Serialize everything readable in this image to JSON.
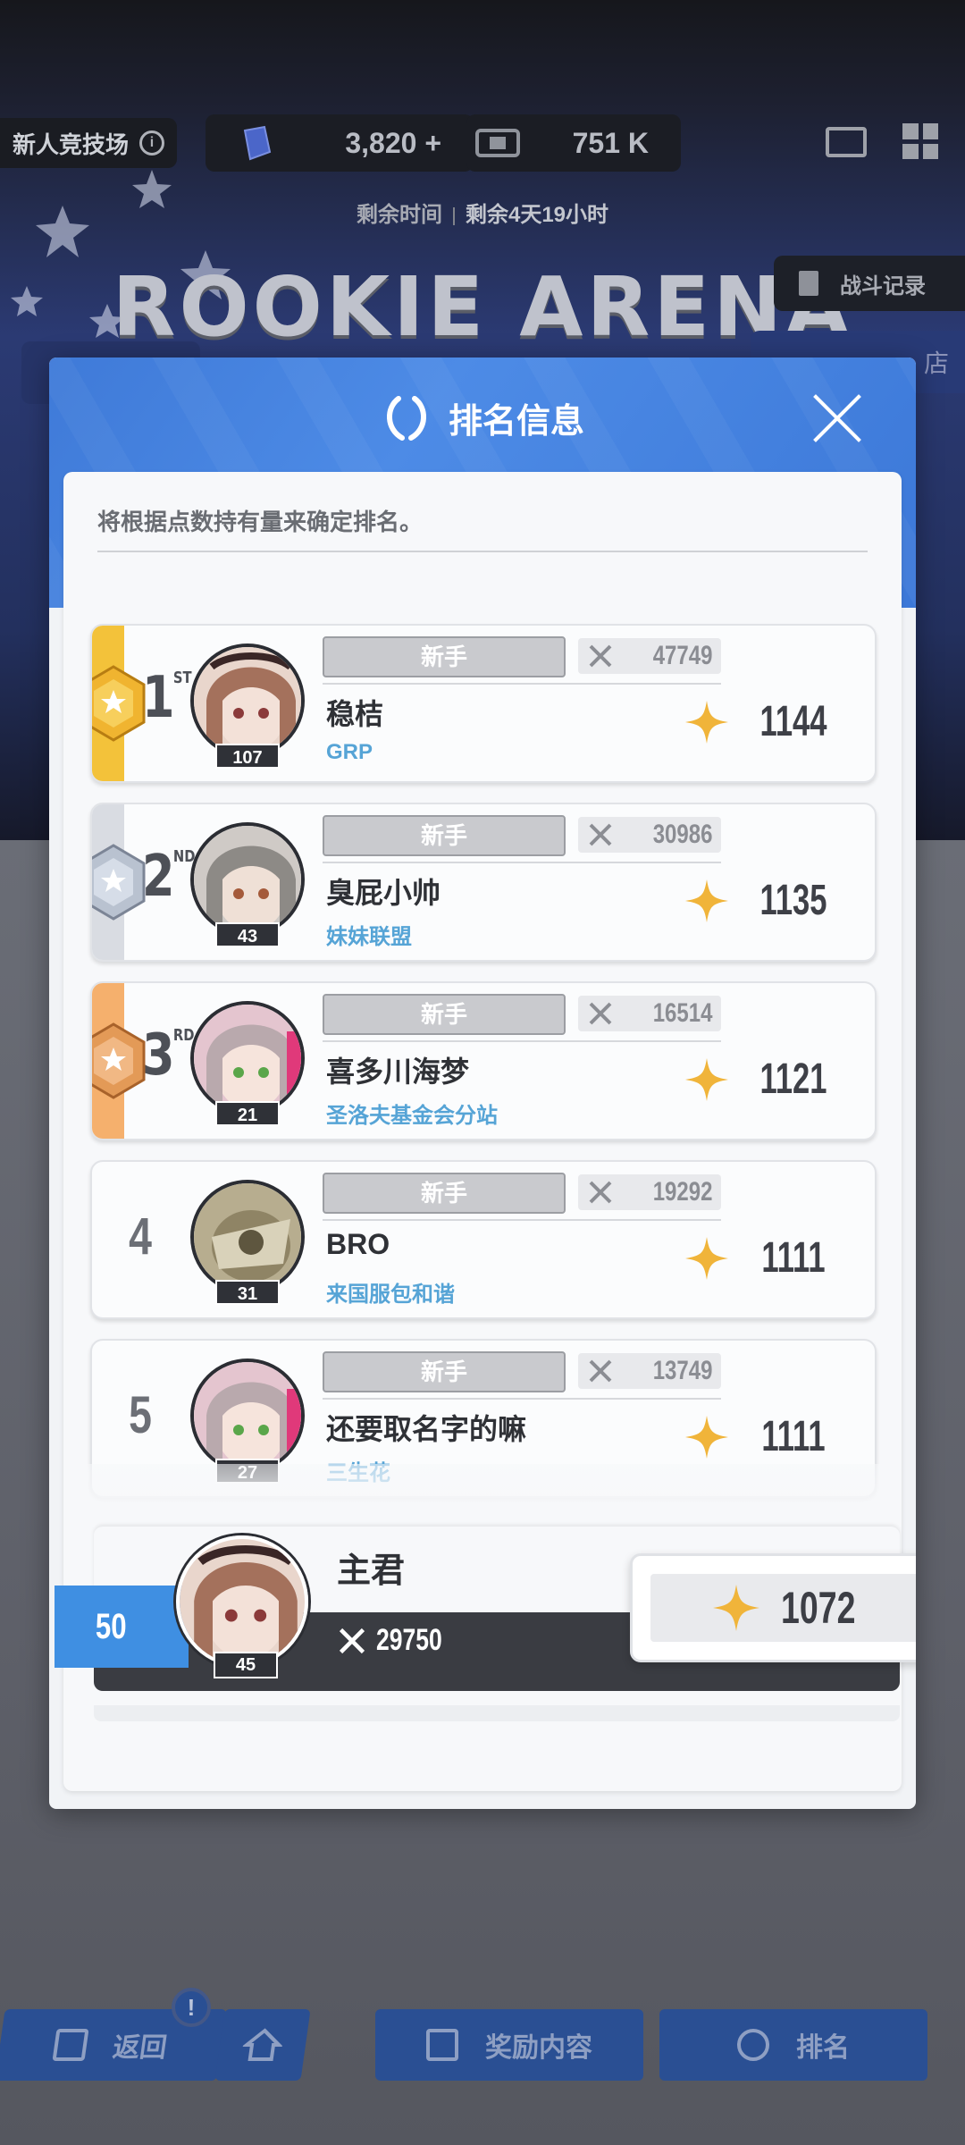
{
  "topbar": {
    "arena_tag": "新人竞技场",
    "info_icon": "i",
    "currency1_value": "3,820",
    "currency1_add": "+",
    "currency2_value": "751 K",
    "remaining_label": "剩余时间",
    "remaining_value": "剩余4天19小时",
    "arena_title": "ROOKIE ARENA",
    "battle_record": "战斗记录",
    "shop": "店"
  },
  "modal": {
    "title": "排名信息",
    "description": "将根据点数持有量来确定排名。"
  },
  "ranking": [
    {
      "rank": "1",
      "suffix": "ST",
      "level": "107",
      "tier": "新手",
      "power": "47749",
      "name": "稳桔",
      "guild": "GRP",
      "points": "1144",
      "medal": "gold"
    },
    {
      "rank": "2",
      "suffix": "ND",
      "level": "43",
      "tier": "新手",
      "power": "30986",
      "name": "臭屁小帅",
      "guild": "妹妹联盟",
      "points": "1135",
      "medal": "silver"
    },
    {
      "rank": "3",
      "suffix": "RD",
      "level": "21",
      "tier": "新手",
      "power": "16514",
      "name": "喜多川海梦",
      "guild": "圣洛夫基金会分站",
      "points": "1121",
      "medal": "bronze"
    },
    {
      "rank": "4",
      "suffix": "",
      "level": "31",
      "tier": "新手",
      "power": "19292",
      "name": "BRO",
      "guild": "来国服包和谐",
      "points": "1111",
      "medal": ""
    },
    {
      "rank": "5",
      "suffix": "",
      "level": "27",
      "tier": "新手",
      "power": "13749",
      "name": "还要取名字的嘛",
      "guild": "三生花",
      "points": "1111",
      "medal": ""
    }
  ],
  "me": {
    "rank": "50",
    "level": "45",
    "name": "主君",
    "power": "29750",
    "points": "1072"
  },
  "bottom_nav": {
    "back": "返回",
    "alert": "!",
    "reward": "奖励内容",
    "rank": "排名"
  },
  "colors": {
    "accent_blue": "#3f8fe2",
    "gold": "#f3c23a",
    "silver": "#d9dce2",
    "bronze": "#f5b06d",
    "guild_blue": "#56a4d6"
  }
}
